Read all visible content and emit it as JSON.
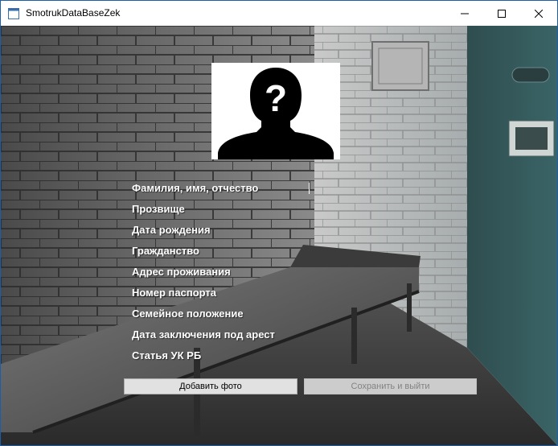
{
  "window": {
    "title": "SmotrukDataBaseZek",
    "controls": [
      "minimize-icon",
      "maximize-icon",
      "close-icon"
    ]
  },
  "photo": {
    "icon": "unknown-person-silhouette-icon"
  },
  "form": {
    "labels": [
      "Фамилия, имя, отчество",
      "Прозвище",
      "Дата рождения",
      "Гражданство",
      "Адрес проживания",
      "Номер паспорта",
      "Семейное положение",
      "Дата заключения под арест",
      "Статья УК РБ"
    ]
  },
  "buttons": {
    "add_photo": "Добавить фото",
    "save_exit": "Сохранить и выйти",
    "save_exit_enabled": false
  },
  "colors": {
    "window_border": "#1c5fa8",
    "label_text": "#ffffff",
    "disabled_text": "#838383"
  }
}
